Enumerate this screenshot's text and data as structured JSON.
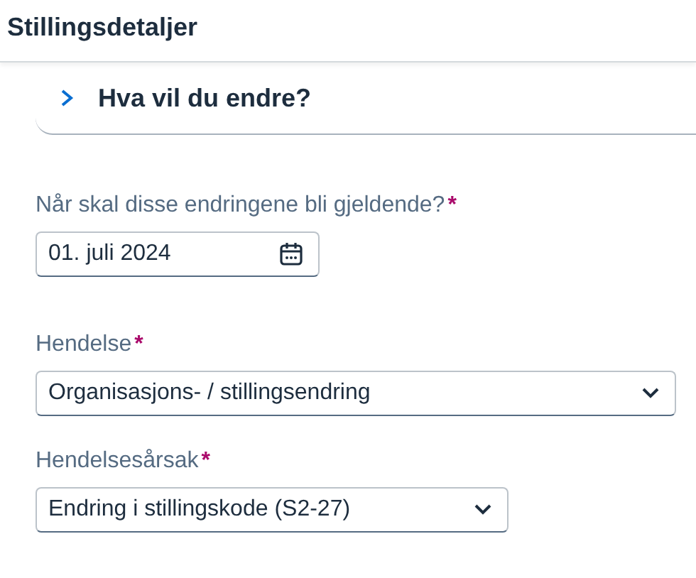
{
  "header": {
    "title": "Stillingsdetaljer"
  },
  "panel": {
    "title": "Hva vil du endre?",
    "expanded": false
  },
  "fields": [
    {
      "kind": "date",
      "label": "Når skal disse endringene bli gjeldende?",
      "required_mark": "*",
      "value": "01. juli 2024"
    },
    {
      "kind": "select",
      "label": "Hendelse",
      "required_mark": "*",
      "value": "Organisasjons- / stillingsendring"
    },
    {
      "kind": "select",
      "label": "Hendelsesårsak",
      "required_mark": "*",
      "value": "Endring i stillingskode (S2-27)"
    }
  ]
}
